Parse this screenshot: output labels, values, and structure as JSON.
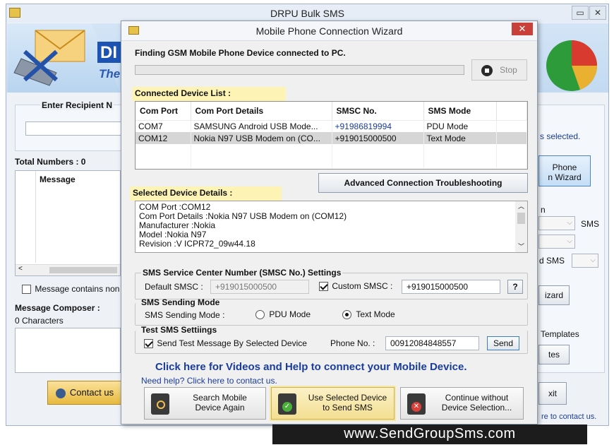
{
  "main": {
    "title": "DRPU Bulk SMS",
    "enter_recipient_label": "Enter Recipient N",
    "total_numbers": "Total Numbers : 0",
    "message_col": "Message",
    "message_contains": "Message contains non",
    "composer_label": "Message Composer :",
    "characters": "0 Characters",
    "contact_button": "Contact us",
    "selected_text": "s selected.",
    "phone_wizard_line1": "Phone",
    "phone_wizard_line2": "n  Wizard",
    "n_label": "n",
    "sms_label": "SMS",
    "d_sms_label": "d SMS",
    "izard_button": "izard",
    "templates_label": "Templates",
    "tes_button": "tes",
    "exit_button": "xit",
    "contact_link": "re to contact us.",
    "banner_text_1": "DI",
    "banner_text_2": "The"
  },
  "wizard": {
    "title": "Mobile Phone Connection Wizard",
    "finding_text": "Finding GSM Mobile Phone Device connected to PC.",
    "progress": 0,
    "stop_button": "Stop",
    "connected_list_label": "Connected Device List :",
    "columns": [
      "Com Port",
      "Com Port Details",
      "SMSC No.",
      "SMS Mode"
    ],
    "rows": [
      [
        "COM7",
        "SAMSUNG Android USB Mode...",
        "+91986819994",
        "PDU Mode"
      ],
      [
        "COM12",
        "Nokia N97 USB Modem on (CO...",
        "+919015000500",
        "Text Mode"
      ]
    ],
    "advanced_button": "Advanced Connection Troubleshooting",
    "selected_details_label": "Selected Device Details :",
    "details_lines": [
      "COM Port :COM12",
      "Com Port Details :Nokia N97 USB Modem on (COM12)",
      "Manufacturer :Nokia",
      "Model :Nokia N97",
      "Revision :V ICPR72_09w44.18"
    ],
    "smsc_group_label": "SMS Service Center Number (SMSC No.) Settings",
    "default_smsc_label": "Default SMSC :",
    "default_smsc_value": "+919015000500",
    "custom_smsc_label": "Custom SMSC :",
    "custom_smsc_value": "+919015000500",
    "help_button": "?",
    "sending_mode_group_label": "SMS Sending Mode",
    "sending_mode_label": "SMS Sending Mode :",
    "pdu_mode_label": "PDU Mode",
    "text_mode_label": "Text Mode",
    "test_group_label": "Test SMS Settiings",
    "send_test_label": "Send Test Message By Selected Device",
    "phone_no_label": "Phone No. :",
    "phone_no_value": "00912084848557",
    "send_button": "Send",
    "videos_link": "Click here for Videos and Help to connect your Mobile Device.",
    "need_help_link": "Need help? Click here to contact us.",
    "search_again_line1": "Search Mobile",
    "search_again_line2": "Device Again",
    "use_selected_line1": "Use Selected Device",
    "use_selected_line2": "to Send SMS",
    "continue_line1": "Continue without",
    "continue_line2": "Device Selection..."
  },
  "watermark": "www.SendGroupSms.com",
  "colors": {
    "link_blue": "#1a3d9c",
    "highlight_yellow": "#fcf3b5",
    "selected_row": "#d6d6d6",
    "close_red": "#c9403a",
    "watermark_bg": "#1c1c1c"
  }
}
